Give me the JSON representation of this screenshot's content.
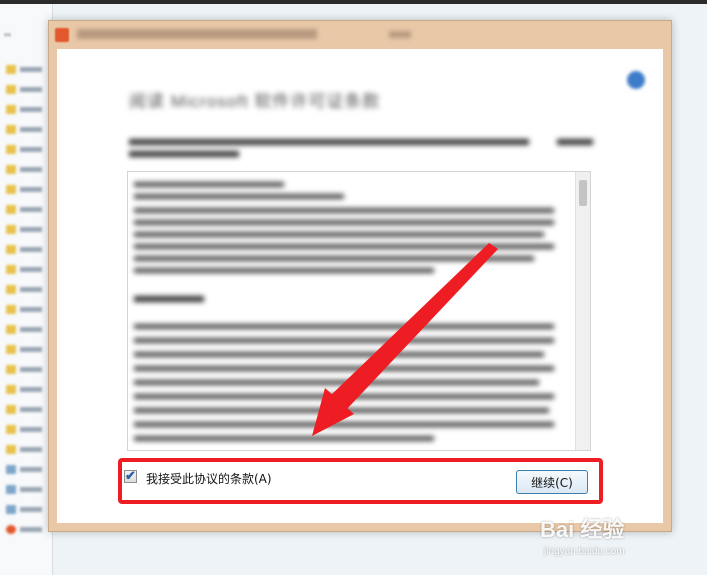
{
  "dialog": {
    "heading": "阅读 Microsoft 软件许可证条款",
    "agree_checkbox": {
      "label": "我接受此协议的条款(A)",
      "checked": true
    },
    "continue_button": "继续(C)"
  },
  "colors": {
    "highlight": "#ee1d23",
    "arrow": "#ee1d23",
    "accent": "#3c7fb1"
  },
  "icons": [
    "office-icon",
    "help-icon",
    "checkmark-icon",
    "folder-icon"
  ],
  "watermark": {
    "logo_text": "Bai 经验",
    "url": "jingyan.baidu.com"
  }
}
